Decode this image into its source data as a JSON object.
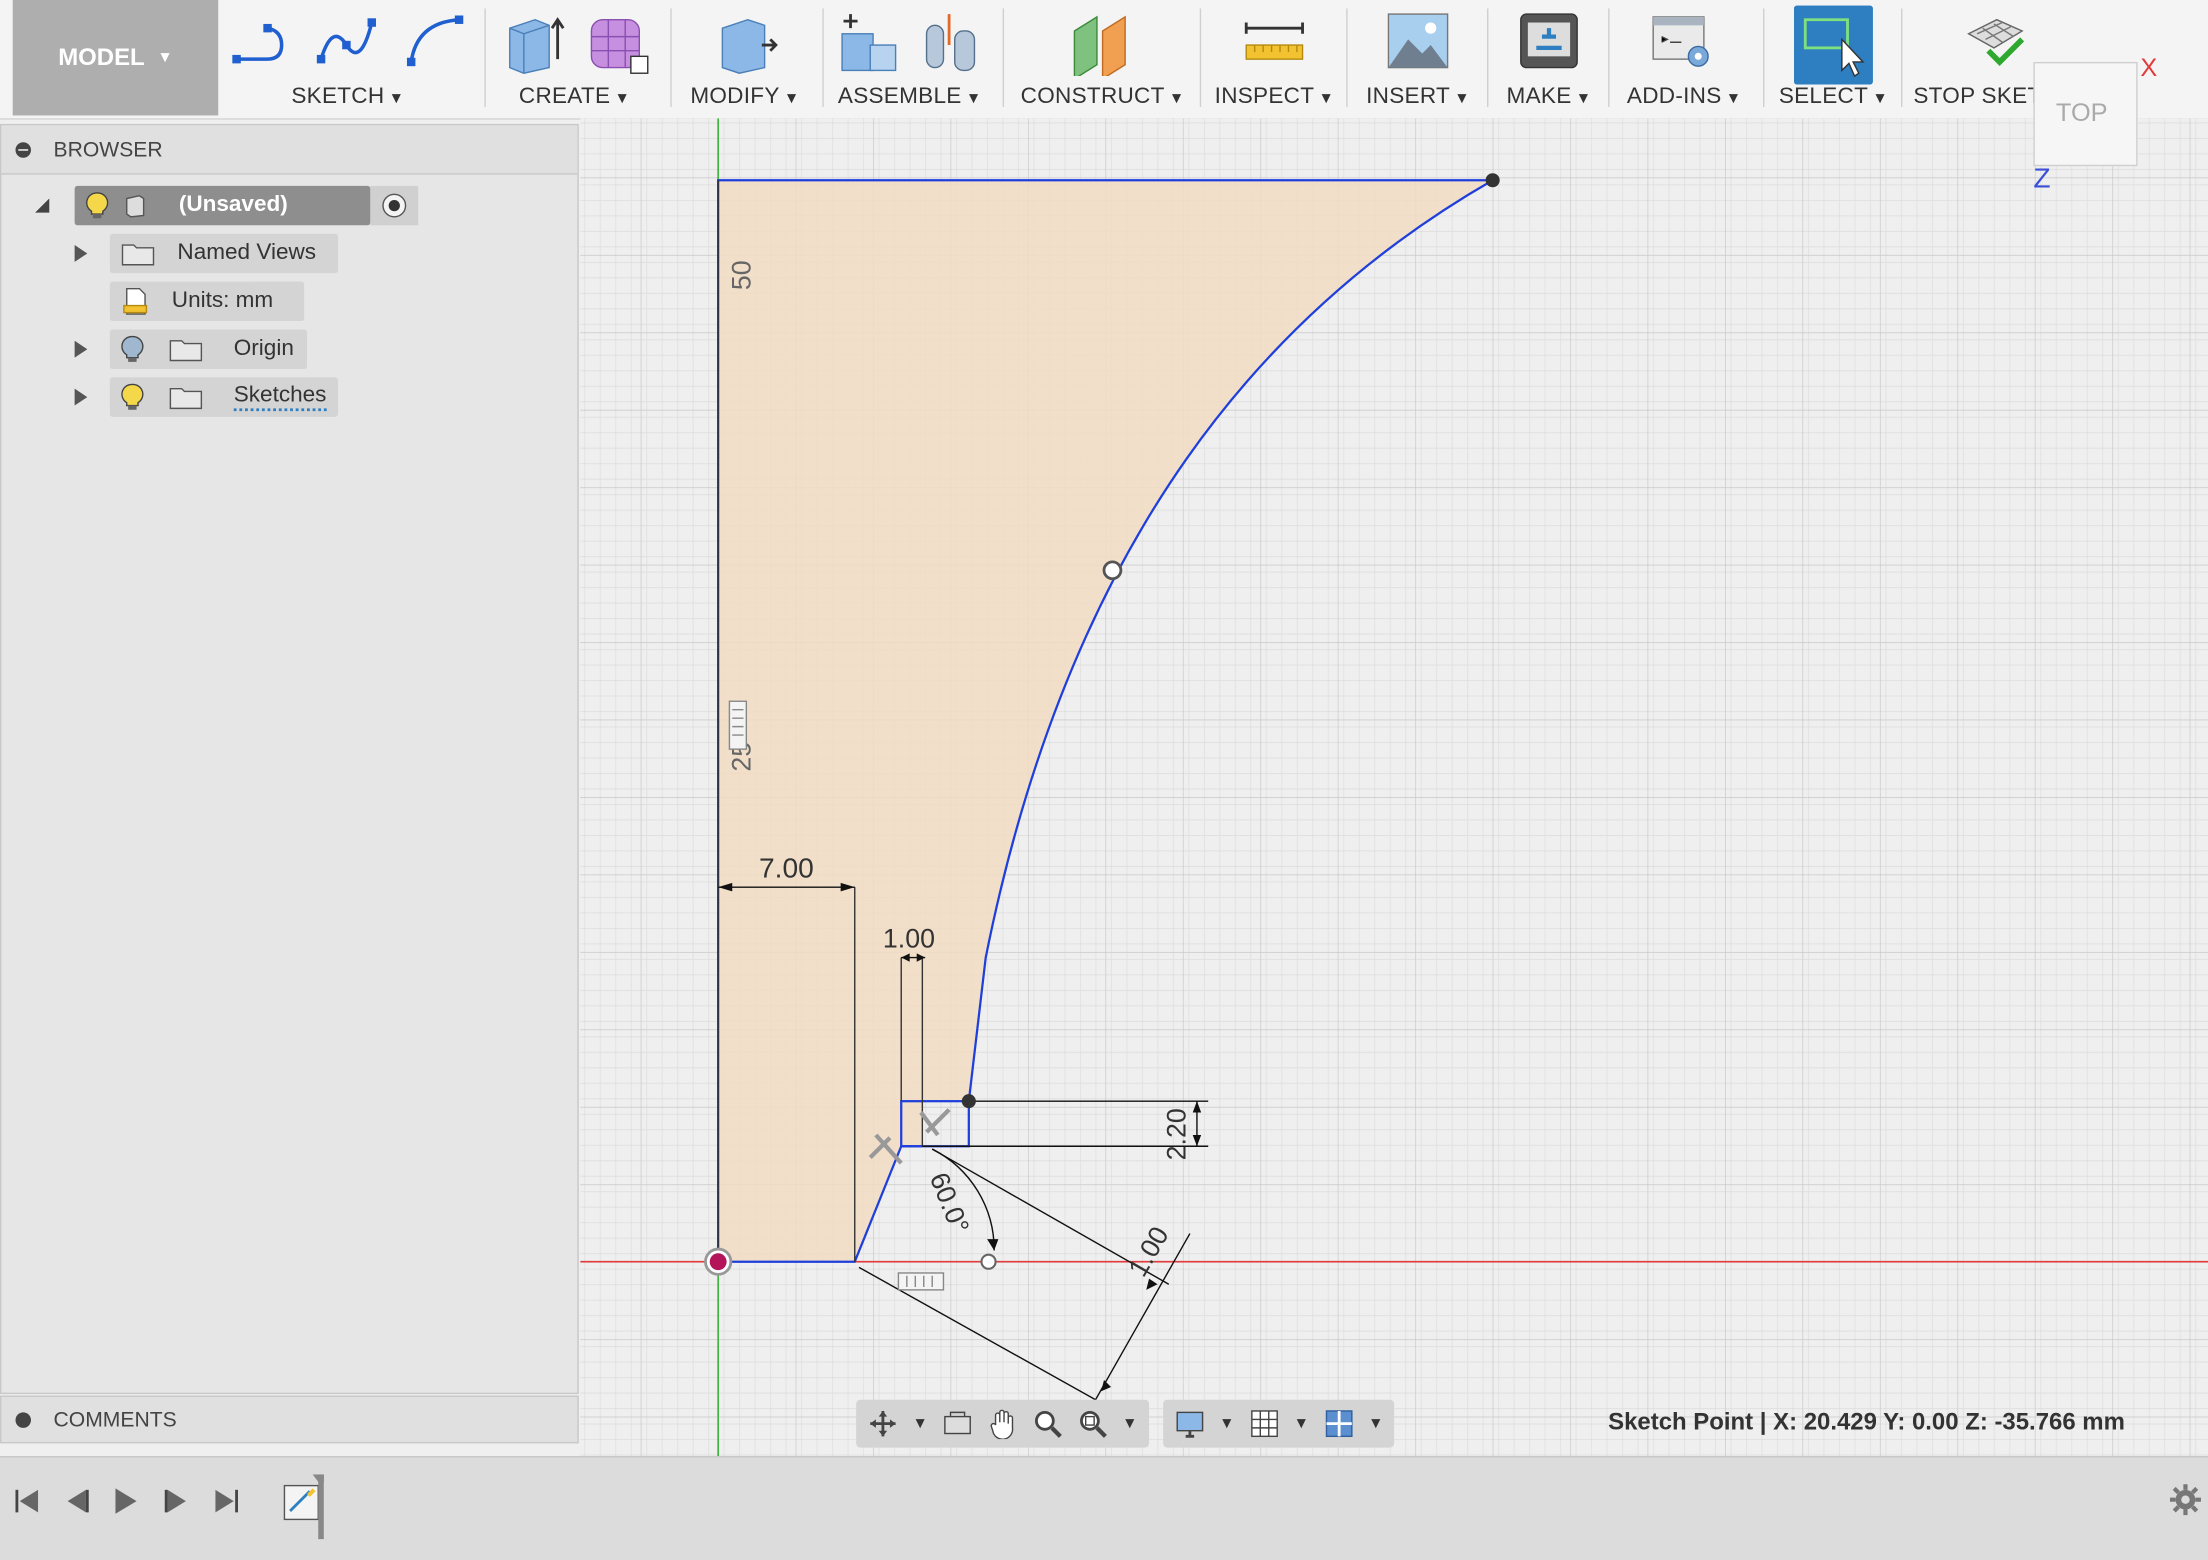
{
  "toolbar": {
    "workspace": "MODEL",
    "groups": [
      "SKETCH",
      "CREATE",
      "MODIFY",
      "ASSEMBLE",
      "CONSTRUCT",
      "INSPECT",
      "INSERT",
      "MAKE",
      "ADD-INS",
      "SELECT",
      "STOP SKETCH"
    ]
  },
  "browser": {
    "title": "BROWSER",
    "root": "(Unsaved)",
    "items": [
      {
        "label": "Named Views"
      },
      {
        "label": "Units: mm"
      },
      {
        "label": "Origin"
      },
      {
        "label": "Sketches"
      }
    ]
  },
  "comments": {
    "title": "COMMENTS"
  },
  "viewcube": {
    "face": "TOP",
    "axis_x": "X",
    "axis_z": "Z"
  },
  "sketch": {
    "dimensions": {
      "d50": "50",
      "d25": "25",
      "d7": "7.00",
      "d1": "1.00",
      "d220": "2.20",
      "angle": "60.0°",
      "d1b": "1.00"
    }
  },
  "status": {
    "text": "Sketch Point | X: 20.429 Y: 0.00 Z: -35.766 mm"
  },
  "colors": {
    "accent": "#2d7fc1",
    "sketch_line": "#1f3fdc",
    "profile_fill": "#f2dcc2",
    "x_axis": "#e23b3b",
    "y_axis": "#41b541"
  }
}
